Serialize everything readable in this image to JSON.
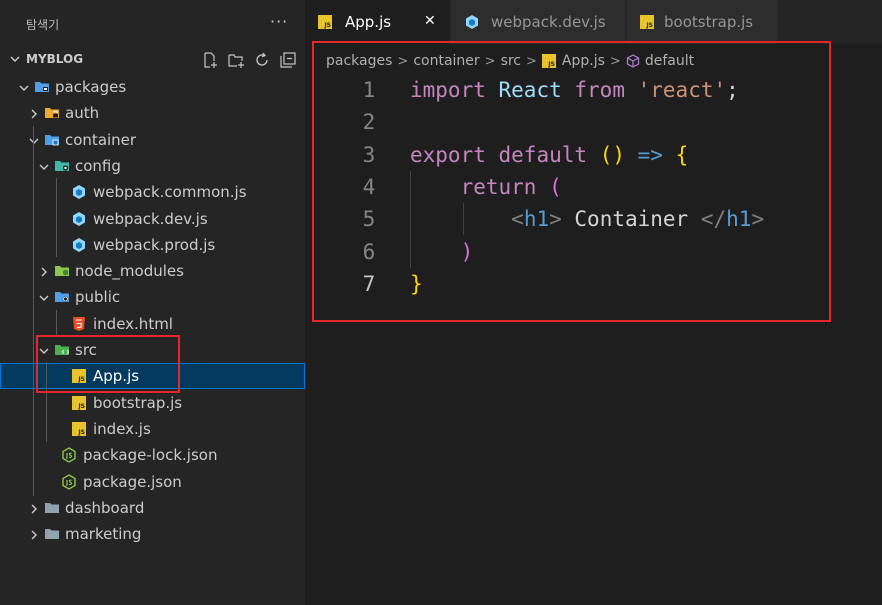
{
  "sidebar": {
    "title": "탐색기",
    "more": "···",
    "root": "MYBLOG",
    "actions": [
      "new-file-icon",
      "new-folder-icon",
      "refresh-icon",
      "collapse-all-icon"
    ],
    "tree": [
      {
        "label": "packages",
        "kind": "folder-open",
        "icon": "packages-folder-icon"
      },
      {
        "label": "auth",
        "kind": "folder",
        "icon": "auth-folder-icon"
      },
      {
        "label": "container",
        "kind": "folder-open",
        "icon": "container-folder-icon"
      },
      {
        "label": "config",
        "kind": "folder-open",
        "icon": "config-folder-icon"
      },
      {
        "label": "webpack.common.js",
        "kind": "file",
        "icon": "webpack-icon"
      },
      {
        "label": "webpack.dev.js",
        "kind": "file",
        "icon": "webpack-icon"
      },
      {
        "label": "webpack.prod.js",
        "kind": "file",
        "icon": "webpack-icon"
      },
      {
        "label": "node_modules",
        "kind": "folder",
        "icon": "node-folder-icon"
      },
      {
        "label": "public",
        "kind": "folder-open",
        "icon": "public-folder-icon"
      },
      {
        "label": "index.html",
        "kind": "file",
        "icon": "html-icon"
      },
      {
        "label": "src",
        "kind": "folder-open",
        "icon": "src-folder-icon"
      },
      {
        "label": "App.js",
        "kind": "file",
        "icon": "js-icon",
        "selected": true
      },
      {
        "label": "bootstrap.js",
        "kind": "file",
        "icon": "js-icon"
      },
      {
        "label": "index.js",
        "kind": "file",
        "icon": "js-icon"
      },
      {
        "label": "package-lock.json",
        "kind": "file",
        "icon": "nodejs-icon"
      },
      {
        "label": "package.json",
        "kind": "file",
        "icon": "nodejs-icon"
      },
      {
        "label": "dashboard",
        "kind": "folder",
        "icon": "folder-icon"
      },
      {
        "label": "marketing",
        "kind": "folder",
        "icon": "folder-icon"
      }
    ]
  },
  "tabs": [
    {
      "label": "App.js",
      "icon": "js-icon",
      "active": true,
      "close": "✕"
    },
    {
      "label": "webpack.dev.js",
      "icon": "webpack-icon",
      "active": false
    },
    {
      "label": "bootstrap.js",
      "icon": "js-icon",
      "active": false
    }
  ],
  "js_badge_text": "JS",
  "breadcrumb": {
    "items": [
      "packages",
      "container",
      "src",
      "App.js",
      "default"
    ],
    "separator": ">"
  },
  "editor": {
    "line_numbers": [
      "1",
      "2",
      "3",
      "4",
      "5",
      "6",
      "7"
    ],
    "current_line": 7,
    "lines": [
      [
        {
          "t": "import",
          "c": "k"
        },
        {
          "t": " ",
          "c": "p"
        },
        {
          "t": "React",
          "c": "id"
        },
        {
          "t": " ",
          "c": "p"
        },
        {
          "t": "from",
          "c": "k"
        },
        {
          "t": " ",
          "c": "p"
        },
        {
          "t": "'react'",
          "c": "str"
        },
        {
          "t": ";",
          "c": "p"
        }
      ],
      [],
      [
        {
          "t": "export",
          "c": "k"
        },
        {
          "t": " ",
          "c": "p"
        },
        {
          "t": "default",
          "c": "k"
        },
        {
          "t": " ",
          "c": "p"
        },
        {
          "t": "()",
          "c": "brace"
        },
        {
          "t": " ",
          "c": "p"
        },
        {
          "t": "=>",
          "c": "kb"
        },
        {
          "t": " ",
          "c": "p"
        },
        {
          "t": "{",
          "c": "brace"
        }
      ],
      [
        {
          "t": "    ",
          "c": "p"
        },
        {
          "t": "return",
          "c": "k"
        },
        {
          "t": " ",
          "c": "p"
        },
        {
          "t": "(",
          "c": "paren2"
        }
      ],
      [
        {
          "t": "        ",
          "c": "p"
        },
        {
          "t": "<",
          "c": "tagp"
        },
        {
          "t": "h1",
          "c": "tag"
        },
        {
          "t": ">",
          "c": "tagp"
        },
        {
          "t": " Container ",
          "c": "p"
        },
        {
          "t": "</",
          "c": "tagp"
        },
        {
          "t": "h1",
          "c": "tag"
        },
        {
          "t": ">",
          "c": "tagp"
        }
      ],
      [
        {
          "t": "    ",
          "c": "p"
        },
        {
          "t": ")",
          "c": "paren2"
        }
      ],
      [
        {
          "t": "}",
          "c": "brace"
        }
      ]
    ]
  },
  "colors": {
    "highlight_box": "#e5262d",
    "selection": "#04395e",
    "js_yellow": "#e8c32b",
    "webpack_blue": "#8ed6fb",
    "node_green": "#8cc84b"
  }
}
